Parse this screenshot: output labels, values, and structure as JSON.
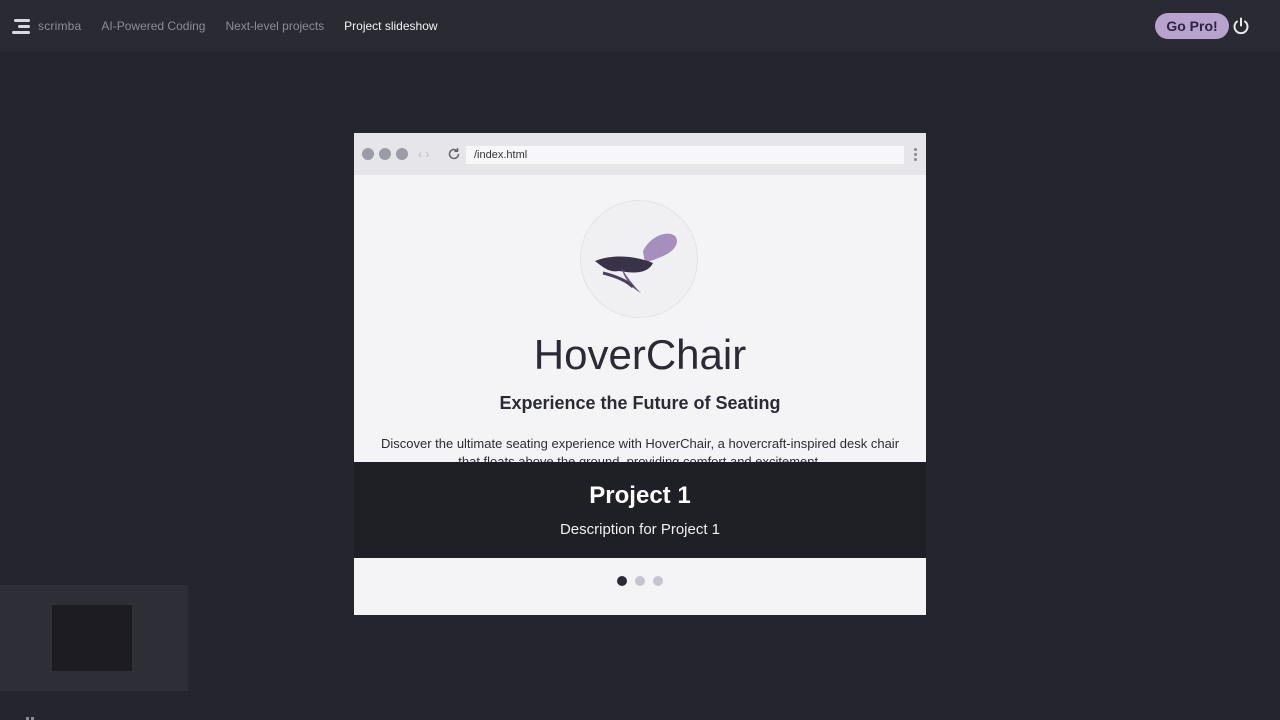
{
  "topbar": {
    "logo_text": "scrimba",
    "crumbs": [
      "AI-Powered Coding",
      "Next-level projects",
      "Project slideshow"
    ],
    "gopro_label": "Go Pro!",
    "power_icon": "power-icon"
  },
  "browser": {
    "url": "/index.html"
  },
  "site": {
    "title": "HoverChair",
    "subtitle": "Experience the Future of Seating",
    "description": "Discover the ultimate seating experience with HoverChair, a hovercraft-inspired desk chair that floats above the ground, providing comfort and excitement."
  },
  "caption": {
    "title": "Project 1",
    "description": "Description for Project 1"
  },
  "indicators": {
    "count": 3,
    "active_index": 0
  },
  "colors": {
    "background": "#25252d",
    "accent": "#b8a3cf"
  }
}
